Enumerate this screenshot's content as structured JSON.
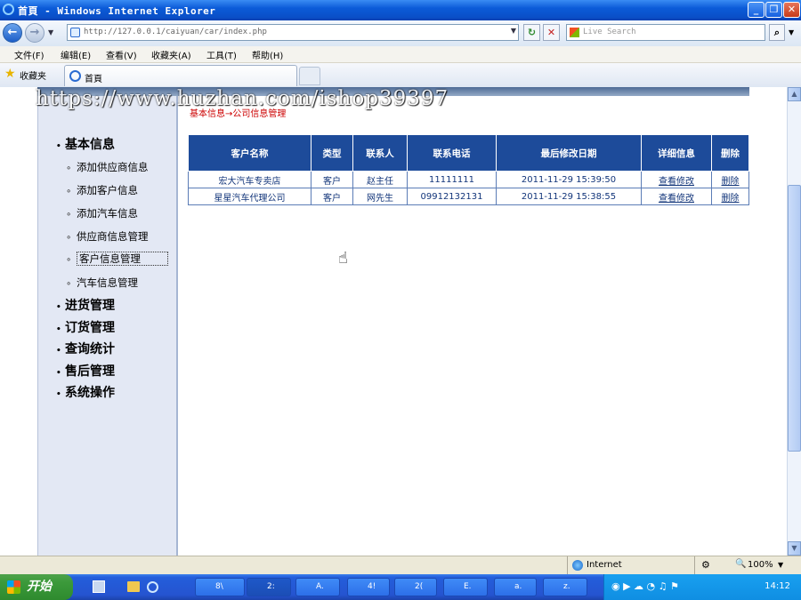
{
  "window": {
    "title": "首頁 - Windows Internet Explorer"
  },
  "toolbar": {
    "url": "http://127.0.0.1/caiyuan/car/index.php",
    "search_placeholder": "Live Search"
  },
  "menu": [
    "文件(F)",
    "编辑(E)",
    "查看(V)",
    "收藏夹(A)",
    "工具(T)",
    "帮助(H)"
  ],
  "favorites": {
    "label": "收藏夹",
    "tab_title": "首頁"
  },
  "watermark": "https://www.huzhan.com/ishop39397",
  "sidebar": {
    "categories": [
      {
        "label": "基本信息",
        "items": [
          "添加供应商信息",
          "添加客户信息",
          "添加汽车信息",
          "供应商信息管理",
          "客户信息管理",
          "汽车信息管理"
        ]
      },
      {
        "label": "进货管理"
      },
      {
        "label": "订货管理"
      },
      {
        "label": "查询统计"
      },
      {
        "label": "售后管理"
      },
      {
        "label": "系统操作"
      }
    ],
    "selected_item": "客户信息管理"
  },
  "main": {
    "breadcrumb": "基本信息→公司信息管理",
    "table": {
      "headers": [
        "客户名称",
        "类型",
        "联系人",
        "联系电话",
        "最后修改日期",
        "详细信息",
        "删除"
      ],
      "rows": [
        [
          "宏大汽车专卖店",
          "客户",
          "赵主任",
          "11111111",
          "2011-11-29 15:39:50",
          "查看修改",
          "删除"
        ],
        [
          "星星汽车代理公司",
          "客户",
          "网先生",
          "09912132131",
          "2011-11-29 15:38:55",
          "查看修改",
          "删除"
        ]
      ]
    }
  },
  "statusbar": {
    "zone": "Internet",
    "zoom": "100%"
  },
  "taskbar": {
    "start_label": "开始",
    "tasks": [
      "8\\",
      "2:",
      "A.",
      "4!",
      "2(",
      "E.",
      "a.",
      "z."
    ],
    "clock": "14:12"
  },
  "colors": {
    "table_header": "#1d4b9a",
    "breadcrumb": "#cc0000",
    "sidebar_bg": "#e3e8f4"
  }
}
